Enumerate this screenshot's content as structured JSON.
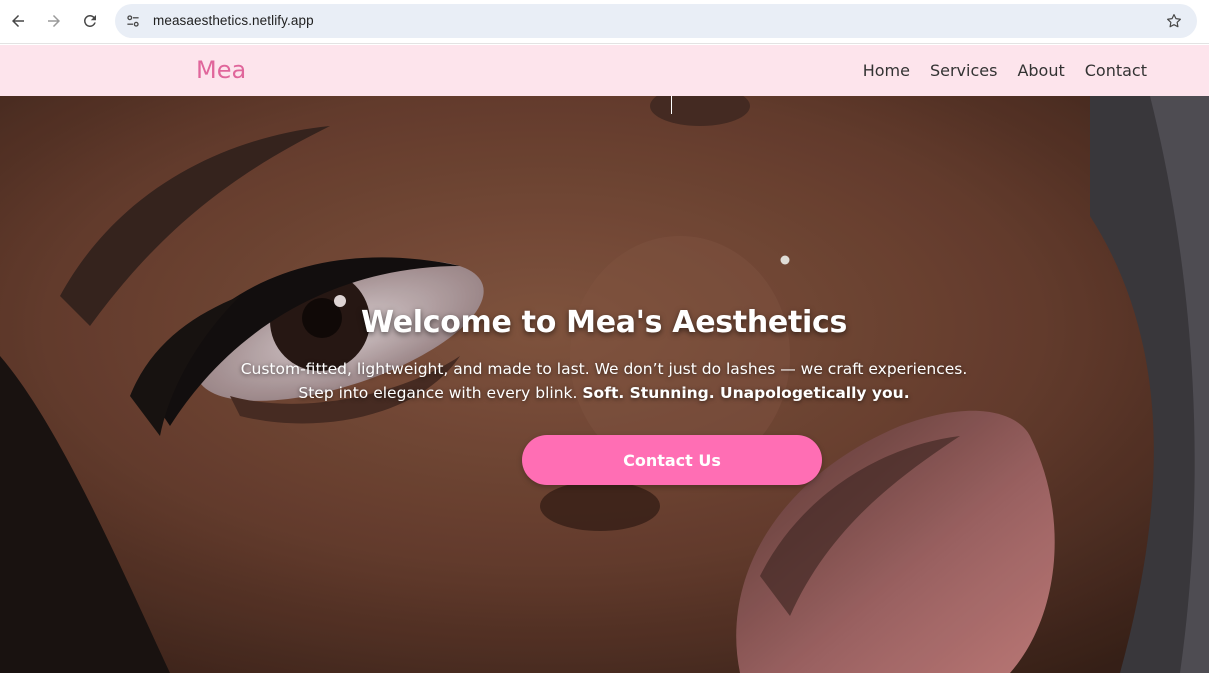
{
  "browser": {
    "url": "measaesthetics.netlify.app",
    "icons": {
      "back": "arrow-left-icon",
      "forward": "arrow-right-icon",
      "reload": "reload-icon",
      "site_info": "tune-icon",
      "bookmark": "star-icon"
    }
  },
  "header": {
    "logo": "Mea",
    "nav": [
      {
        "label": "Home"
      },
      {
        "label": "Services"
      },
      {
        "label": "About"
      },
      {
        "label": "Contact"
      }
    ]
  },
  "hero": {
    "title": "Welcome to Mea's Aesthetics",
    "line1": "Custom-fitted, lightweight, and made to last. We don’t just do lashes — we craft experiences.",
    "line2": "Step into elegance with every blink.",
    "tagline": "Soft. Stunning. Unapologetically you.",
    "cta_label": "Contact Us"
  },
  "colors": {
    "header_bg": "#fde4ec",
    "logo": "#e0669b",
    "cta_bg": "#ff6eb4",
    "omnibox_bg": "#e9eef6"
  }
}
